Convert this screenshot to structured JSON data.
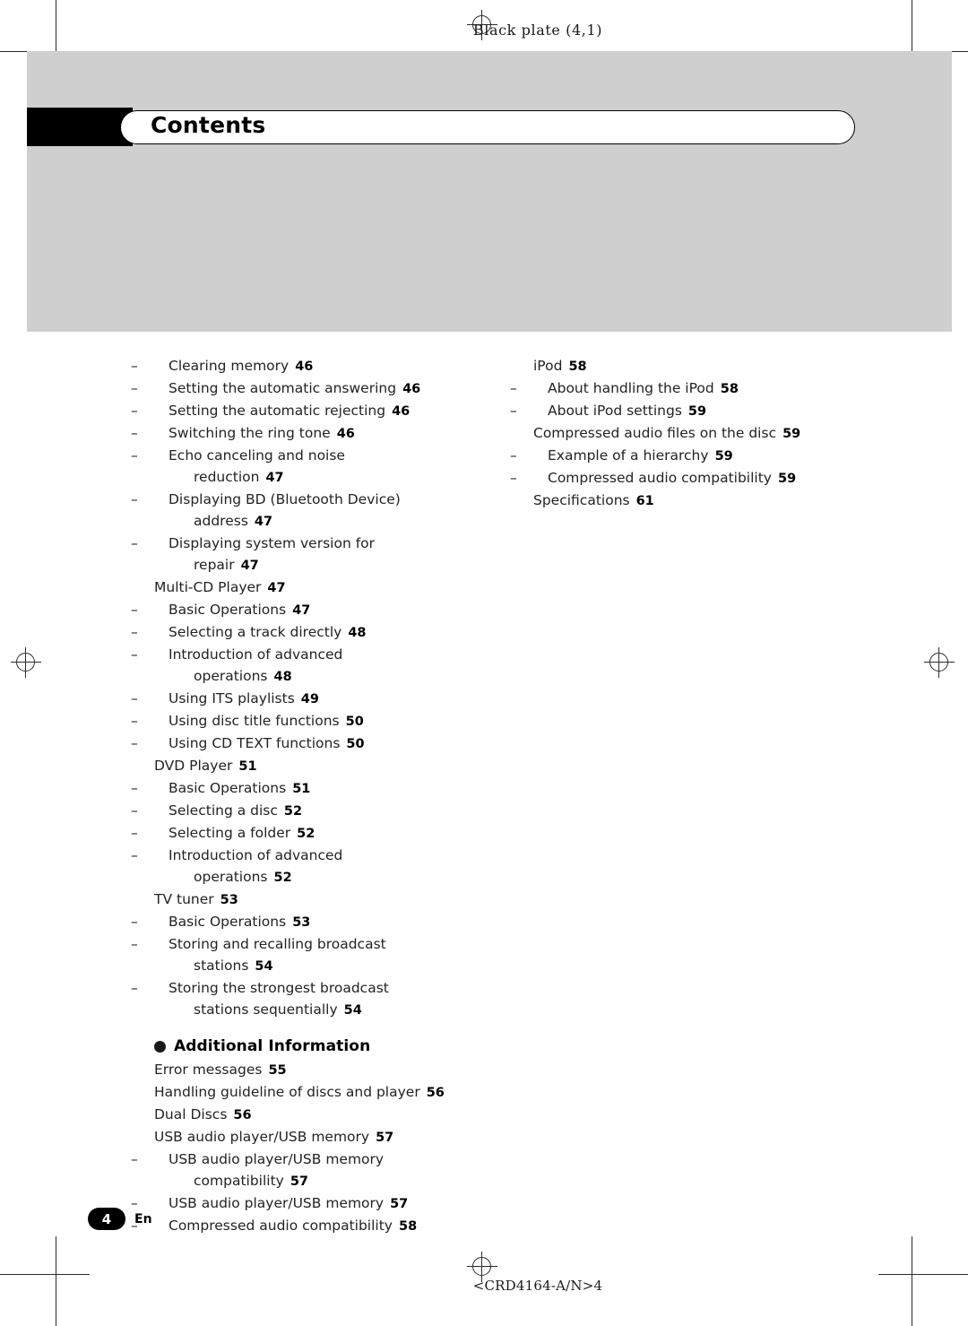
{
  "page": {
    "plate_label": "Black plate (4,1)",
    "footer_code": "<CRD4164-A/N>4",
    "page_number": "4",
    "language_code": "En",
    "title": "Contents"
  },
  "left_column": [
    {
      "level": 2,
      "text": "Clearing memory",
      "page": "46"
    },
    {
      "level": 2,
      "text": "Setting the automatic answering",
      "page": "46"
    },
    {
      "level": 2,
      "text": "Setting the automatic rejecting",
      "page": "46"
    },
    {
      "level": 2,
      "text": "Switching the ring tone",
      "page": "46"
    },
    {
      "level": 2,
      "text": "Echo canceling and noise",
      "page": ""
    },
    {
      "level": 3,
      "text": "reduction",
      "page": "47"
    },
    {
      "level": 2,
      "text": "Displaying BD (Bluetooth Device)",
      "page": ""
    },
    {
      "level": 3,
      "text": "address",
      "page": "47"
    },
    {
      "level": 2,
      "text": "Displaying system version for",
      "page": ""
    },
    {
      "level": 3,
      "text": "repair",
      "page": "47"
    },
    {
      "level": 1,
      "text": "Multi-CD Player",
      "page": "47"
    },
    {
      "level": 2,
      "text": "Basic Operations",
      "page": "47"
    },
    {
      "level": 2,
      "text": "Selecting a track directly",
      "page": "48"
    },
    {
      "level": 2,
      "text": "Introduction of advanced",
      "page": ""
    },
    {
      "level": 3,
      "text": "operations",
      "page": "48"
    },
    {
      "level": 2,
      "text": "Using ITS playlists",
      "page": "49"
    },
    {
      "level": 2,
      "text": "Using disc title functions",
      "page": "50"
    },
    {
      "level": 2,
      "text": "Using CD TEXT functions",
      "page": "50"
    },
    {
      "level": 1,
      "text": "DVD Player",
      "page": "51"
    },
    {
      "level": 2,
      "text": "Basic Operations",
      "page": "51"
    },
    {
      "level": 2,
      "text": "Selecting a disc",
      "page": "52"
    },
    {
      "level": 2,
      "text": "Selecting a folder",
      "page": "52"
    },
    {
      "level": 2,
      "text": "Introduction of advanced",
      "page": ""
    },
    {
      "level": 3,
      "text": "operations",
      "page": "52"
    },
    {
      "level": 1,
      "text": "TV tuner",
      "page": "53"
    },
    {
      "level": 2,
      "text": "Basic Operations",
      "page": "53"
    },
    {
      "level": 2,
      "text": "Storing and recalling broadcast",
      "page": ""
    },
    {
      "level": 3,
      "text": "stations",
      "page": "54"
    },
    {
      "level": 2,
      "text": "Storing the strongest broadcast",
      "page": ""
    },
    {
      "level": 3,
      "text": "stations sequentially",
      "page": "54"
    }
  ],
  "left_column_section": {
    "heading": "Additional Information",
    "items": [
      {
        "level": 1,
        "text": "Error messages",
        "page": "55"
      },
      {
        "level": 1,
        "text": "Handling guideline of discs and player",
        "page": "56"
      },
      {
        "level": 1,
        "text": "Dual Discs",
        "page": "56"
      },
      {
        "level": 1,
        "text": "USB audio player/USB memory",
        "page": "57"
      },
      {
        "level": 2,
        "text": "USB audio player/USB memory",
        "page": ""
      },
      {
        "level": 3,
        "text": "compatibility",
        "page": "57"
      },
      {
        "level": 2,
        "text": "USB audio player/USB memory",
        "page": "57"
      },
      {
        "level": 2,
        "text": "Compressed audio compatibility",
        "page": "58"
      }
    ]
  },
  "right_column": [
    {
      "level": 1,
      "text": "iPod",
      "page": "58"
    },
    {
      "level": 2,
      "text": "About handling the iPod",
      "page": "58"
    },
    {
      "level": 2,
      "text": "About iPod settings",
      "page": "59"
    },
    {
      "level": 1,
      "text": "Compressed audio files on the disc",
      "page": "59"
    },
    {
      "level": 2,
      "text": "Example of a hierarchy",
      "page": "59"
    },
    {
      "level": 2,
      "text": "Compressed audio compatibility",
      "page": "59"
    },
    {
      "level": 1,
      "text": "Specifications",
      "page": "61"
    }
  ]
}
